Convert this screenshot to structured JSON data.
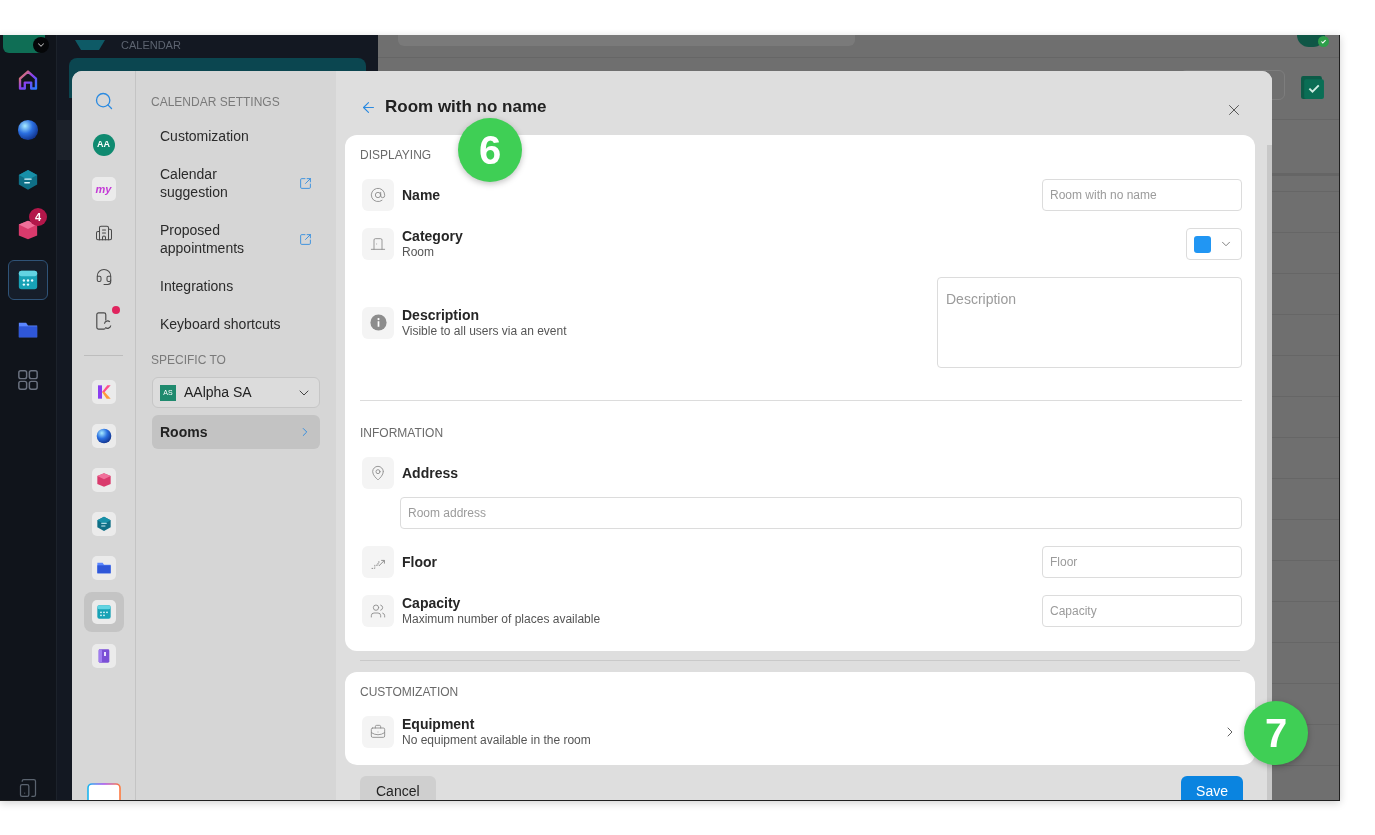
{
  "app_bar": {
    "apps": [
      {
        "kind": "home",
        "selected": false
      },
      {
        "kind": "sphere",
        "selected": false
      },
      {
        "kind": "chat",
        "selected": false
      },
      {
        "kind": "mail",
        "selected": false,
        "badge": "4"
      },
      {
        "kind": "calendar",
        "selected": true
      },
      {
        "kind": "folder",
        "selected": false
      },
      {
        "kind": "grid",
        "selected": false
      }
    ]
  },
  "calendar_panel": {
    "title": "CALENDAR"
  },
  "settings": {
    "rail": {
      "tools": [
        {
          "kind": "search",
          "selected": false
        },
        {
          "kind": "avatar",
          "label": "AA",
          "selected": false
        },
        {
          "kind": "my",
          "label": "my",
          "selected": false
        },
        {
          "kind": "building",
          "selected": false
        },
        {
          "kind": "support",
          "selected": false
        },
        {
          "kind": "sync",
          "selected": false,
          "notification": true
        }
      ],
      "apps": [
        {
          "kind": "k",
          "selected": false
        },
        {
          "kind": "sphere",
          "selected": false
        },
        {
          "kind": "mail",
          "selected": false
        },
        {
          "kind": "chat",
          "selected": false
        },
        {
          "kind": "folder",
          "selected": false
        },
        {
          "kind": "calendar",
          "selected": true
        },
        {
          "kind": "book",
          "selected": false
        }
      ]
    },
    "nav": {
      "heading": "CALENDAR SETTINGS",
      "items": [
        {
          "label": "Customization",
          "external": false,
          "selected": false
        },
        {
          "label": "Calendar suggestion",
          "external": true,
          "selected": false
        },
        {
          "label": "Proposed appointments",
          "external": true,
          "selected": false
        },
        {
          "label": "Integrations",
          "external": false,
          "selected": false
        },
        {
          "label": "Keyboard shortcuts",
          "external": false,
          "selected": false
        }
      ],
      "scope_heading": "SPECIFIC TO",
      "organization": {
        "badge": "AS",
        "name": "AAlpha SA"
      },
      "scope_items": [
        {
          "label": "Rooms",
          "selected": true
        }
      ]
    },
    "panel": {
      "title": "Room with no name",
      "cards": [
        {
          "sections": [
            {
              "heading": "DISPLAYING",
              "rows": [
                {
                  "kind": "name",
                  "label": "Name",
                  "placeholder": "Room with no name"
                },
                {
                  "kind": "category",
                  "label": "Category",
                  "subtitle": "Room",
                  "color": "#2196f3"
                },
                {
                  "kind": "description",
                  "label": "Description",
                  "subtitle": "Visible to all users via an event",
                  "placeholder": "Description"
                }
              ]
            },
            {
              "heading": "INFORMATION",
              "rows": [
                {
                  "kind": "address",
                  "label": "Address",
                  "placeholder": "Room address"
                },
                {
                  "kind": "floor",
                  "label": "Floor",
                  "placeholder": "Floor"
                },
                {
                  "kind": "capacity",
                  "label": "Capacity",
                  "subtitle": "Maximum number of places available",
                  "placeholder": "Capacity"
                }
              ]
            }
          ]
        },
        {
          "sections": [
            {
              "heading": "CUSTOMIZATION",
              "rows": [
                {
                  "kind": "equipment",
                  "label": "Equipment",
                  "subtitle": "No equipment available in the room"
                }
              ]
            }
          ]
        }
      ],
      "buttons": [
        {
          "label": "Cancel",
          "kind": "secondary"
        },
        {
          "label": "Save",
          "kind": "primary"
        }
      ]
    }
  },
  "callouts": [
    {
      "label": "6"
    },
    {
      "label": "7"
    }
  ]
}
